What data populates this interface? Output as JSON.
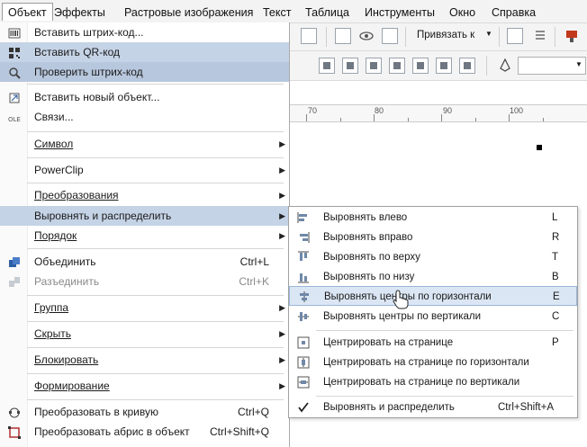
{
  "menubar": {
    "items": [
      "Объект",
      "Эффекты",
      "Растровые изображения",
      "Текст",
      "Таблица",
      "Инструменты",
      "Окно",
      "Справка"
    ]
  },
  "toolbar": {
    "snap_label": "Привязать к"
  },
  "ruler": {
    "labels": [
      "70",
      "80",
      "90",
      "100"
    ]
  },
  "menu": {
    "items": [
      {
        "label": "Вставить штрих-код...",
        "icon": "barcode-icon"
      },
      {
        "label": "Вставить QR-код",
        "icon": "qr-code-icon"
      },
      {
        "label": "Проверить штрих-код",
        "icon": "magnifier-icon"
      },
      {
        "label": "Вставить новый объект...",
        "icon": "insert-object-icon"
      },
      {
        "label": "Связи...",
        "icon": "ole-icon"
      },
      {
        "label": "Символ"
      },
      {
        "label": "PowerClip"
      },
      {
        "label": "Преобразования"
      },
      {
        "label": "Выровнять и распределить"
      },
      {
        "label": "Порядок"
      },
      {
        "label": "Объединить",
        "shortcut": "Ctrl+L",
        "icon": "combine-icon"
      },
      {
        "label": "Разъединить",
        "shortcut": "Ctrl+K",
        "icon": "break-apart-icon"
      },
      {
        "label": "Группа"
      },
      {
        "label": "Скрыть"
      },
      {
        "label": "Блокировать"
      },
      {
        "label": "Формирование"
      },
      {
        "label": "Преобразовать в кривую",
        "shortcut": "Ctrl+Q",
        "icon": "convert-to-curves-icon"
      },
      {
        "label": "Преобразовать абрис в объект",
        "shortcut": "Ctrl+Shift+Q",
        "icon": "outline-to-object-icon"
      }
    ]
  },
  "submenu": {
    "items": [
      {
        "label": "Выровнять влево",
        "shortcut": "L"
      },
      {
        "label": "Выровнять вправо",
        "shortcut": "R"
      },
      {
        "label": "Выровнять по верху",
        "shortcut": "T"
      },
      {
        "label": "Выровнять по низу",
        "shortcut": "B"
      },
      {
        "label": "Выровнять центры по горизонтали",
        "shortcut": "E"
      },
      {
        "label": "Выровнять центры по вертикали",
        "shortcut": "C"
      },
      {
        "label": "Центрировать на странице",
        "shortcut": "P"
      },
      {
        "label": "Центрировать на странице по горизонтали"
      },
      {
        "label": "Центрировать на странице по вертикали"
      },
      {
        "label": "Выровнять и распределить",
        "shortcut": "Ctrl+Shift+A"
      }
    ]
  }
}
